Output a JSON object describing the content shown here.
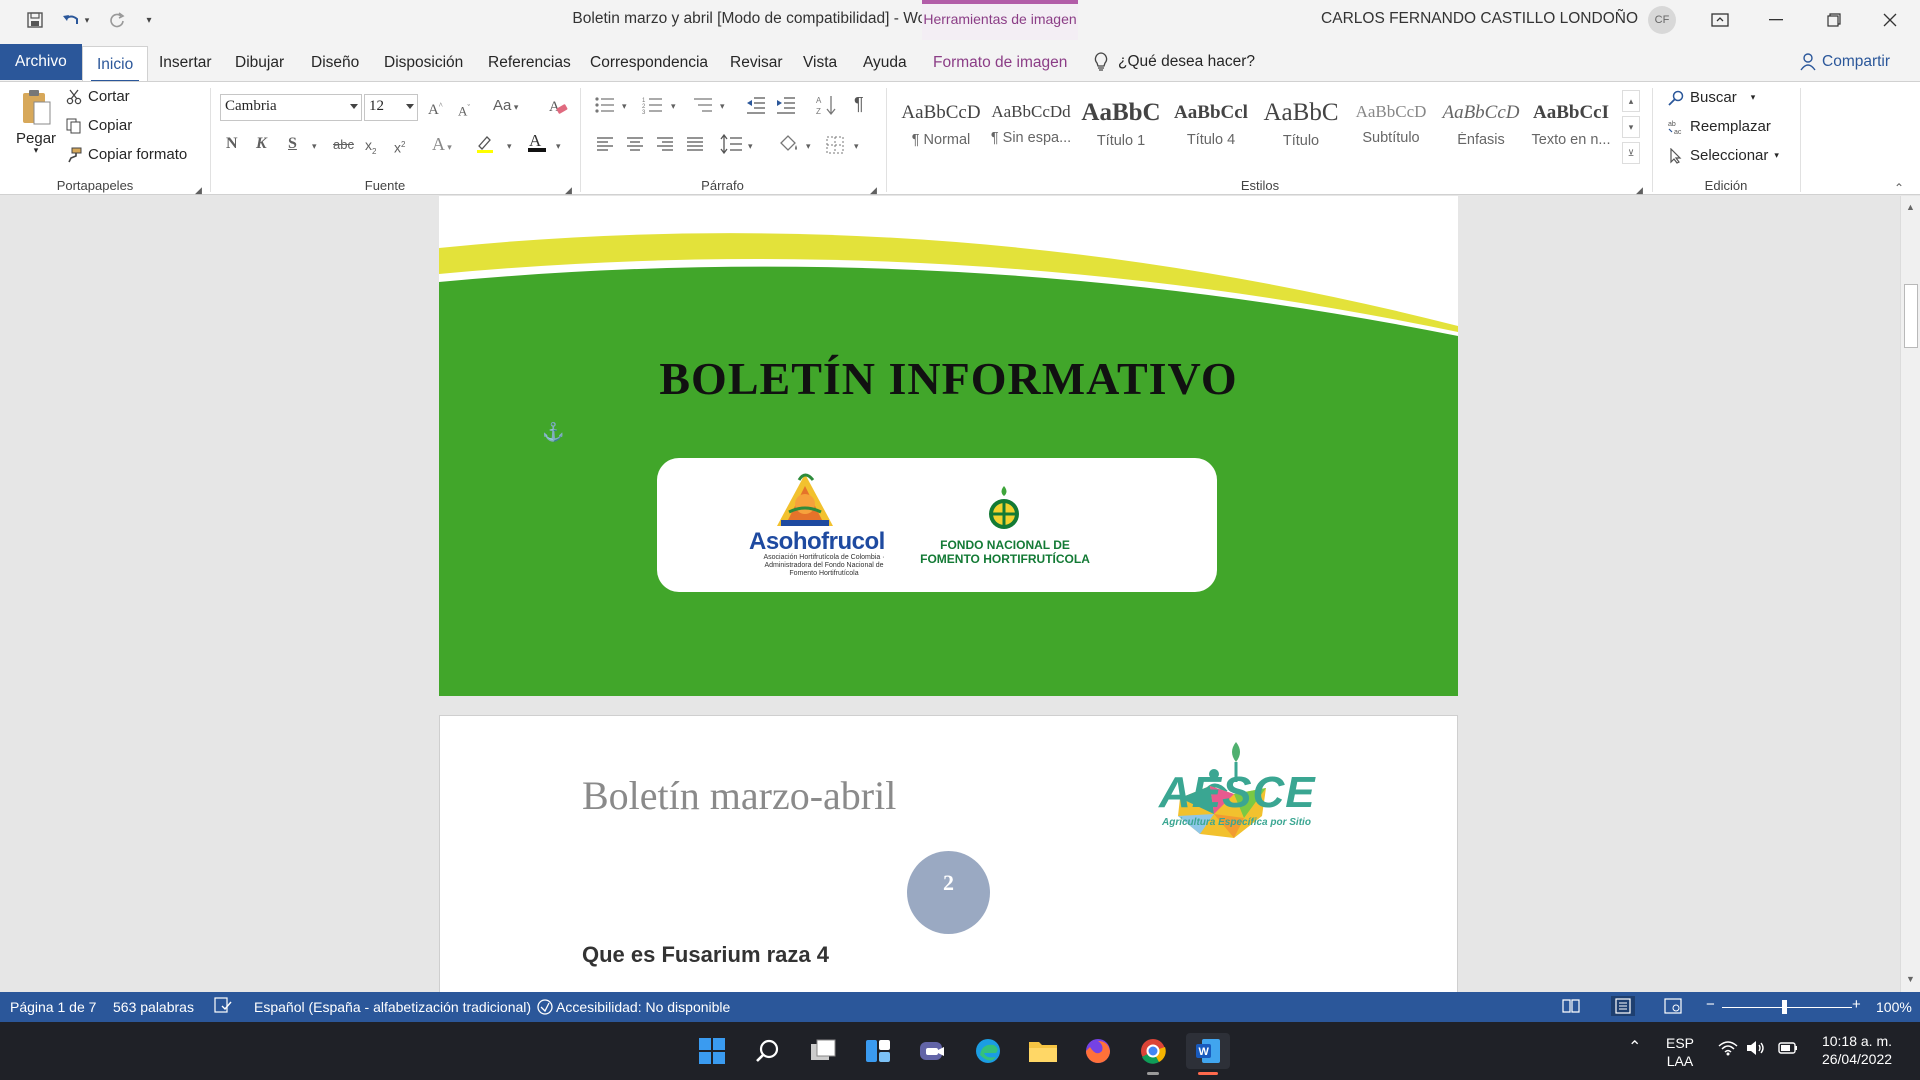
{
  "titlebar": {
    "document_title": "Boletin marzo y abril [Modo de compatibilidad]  -  Word",
    "contextual_tab": "Herramientas de imagen",
    "user_name": "CARLOS FERNANDO CASTILLO LONDOÑO",
    "user_initials": "CF"
  },
  "tabs": {
    "archivo": "Archivo",
    "inicio": "Inicio",
    "insertar": "Insertar",
    "dibujar": "Dibujar",
    "diseno": "Diseño",
    "disposicion": "Disposición",
    "referencias": "Referencias",
    "correspondencia": "Correspondencia",
    "revisar": "Revisar",
    "vista": "Vista",
    "ayuda": "Ayuda",
    "formato_imagen": "Formato de imagen",
    "tell_me": "¿Qué desea hacer?",
    "share": "Compartir"
  },
  "ribbon": {
    "clipboard": {
      "paste": "Pegar",
      "cut": "Cortar",
      "copy": "Copiar",
      "format_painter": "Copiar formato",
      "label": "Portapapeles"
    },
    "font": {
      "name": "Cambria",
      "size": "12",
      "label": "Fuente",
      "bold": "N",
      "italic": "K",
      "underline": "S",
      "strike": "abc",
      "case": "Aa"
    },
    "paragraph": {
      "label": "Párrafo"
    },
    "styles": {
      "label": "Estilos",
      "items": [
        {
          "sample": "AaBbCcD",
          "name": "¶ Normal"
        },
        {
          "sample": "AaBbCcDd",
          "name": "¶ Sin espa..."
        },
        {
          "sample": "AaBbC",
          "name": "Título 1"
        },
        {
          "sample": "AaBbCcl",
          "name": "Título 4"
        },
        {
          "sample": "AaBbC",
          "name": "Título"
        },
        {
          "sample": "AaBbCcD",
          "name": "Subtítulo"
        },
        {
          "sample": "AaBbCcD",
          "name": "Énfasis"
        },
        {
          "sample": "AaBbCcI",
          "name": "Texto en n..."
        }
      ]
    },
    "editing": {
      "label": "Edición",
      "find": "Buscar",
      "replace": "Reemplazar",
      "select": "Seleccionar"
    }
  },
  "document": {
    "cover_title": "BOLETÍN INFORMATIVO",
    "logo_asoh": "Asohofrucol",
    "logo_asoh_sub": "Asociación Hortifrutícola de Colombia · Administradora del Fondo Nacional de Fomento Hortifrutícola",
    "logo_fondo": "FONDO NACIONAL DE FOMENTO HORTIFRUTÍCOLA",
    "page2_title": "Boletín marzo-abril",
    "page_number": "2",
    "section_heading": "Que es Fusarium raza 4",
    "aesce": "AESCE",
    "aesce_sub": "Agricultura Específica por Sitio"
  },
  "statusbar": {
    "page": "Página 1 de 7",
    "words": "563 palabras",
    "language": "Español (España - alfabetización tradicional)",
    "accessibility": "Accesibilidad: No disponible",
    "zoom": "100%"
  },
  "taskbar": {
    "lang_top": "ESP",
    "lang_bottom": "LAA",
    "time": "10:18 a. m.",
    "date": "26/04/2022"
  },
  "colors": {
    "word_blue": "#2b579a",
    "cover_green": "#41a62a",
    "cover_yellow": "#e3e23a",
    "taskbar": "#1f2127"
  }
}
